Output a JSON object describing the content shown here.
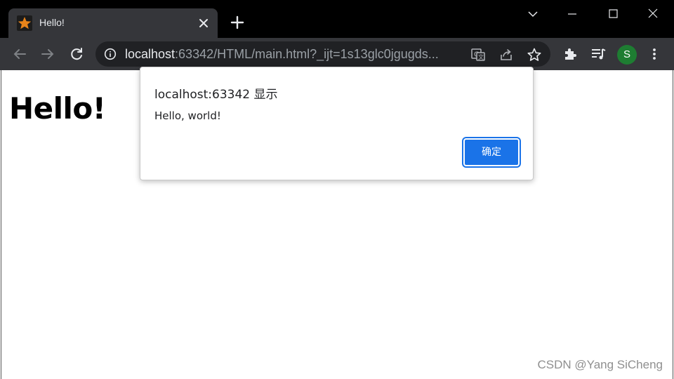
{
  "browser": {
    "tab": {
      "title": "Hello!",
      "favicon": "star-icon"
    },
    "address": {
      "host": "localhost",
      "path": ":63342/HTML/main.html?_ijt=1s13glc0jgugds..."
    },
    "profile_initial": "S"
  },
  "page": {
    "heading": "Hello!",
    "watermark": "CSDN @Yang SiCheng"
  },
  "dialog": {
    "title": "localhost:63342 显示",
    "message": "Hello, world!",
    "ok_label": "确定"
  },
  "colors": {
    "titlebar": "#000000",
    "toolbar": "#35363a",
    "omnibox": "#202124",
    "accent": "#1a73e8",
    "avatar": "#1e7d32"
  }
}
